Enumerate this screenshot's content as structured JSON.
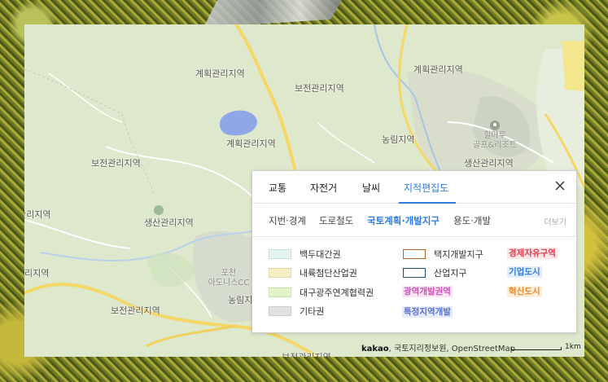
{
  "map": {
    "region_labels": [
      "계획관리지역",
      "보전관리지역",
      "계획관리지역",
      "계획관리지역",
      "농림지역",
      "보전관리지역",
      "생산관리지역",
      "관리지역",
      "생산관리지역",
      "리지역",
      "보전관리지역",
      "농림지",
      "보전관리지역"
    ],
    "poi": {
      "golf_line1": "힐마루",
      "golf_line2": "골프&리조트",
      "park_name": "포천",
      "park_sub": "아도니스CC"
    },
    "attribution": {
      "brand": "kakao",
      "text": ", 국토지리정보원, OpenStreetMap"
    },
    "scale_label": "1km"
  },
  "panel": {
    "tabs": [
      "교통",
      "자전거",
      "날씨",
      "지적편집도"
    ],
    "active_tab": "지적편집도",
    "close_icon": "close-icon",
    "subtabs": [
      "지번·경계",
      "도로철도",
      "국토계획·개발지구",
      "용도·개발"
    ],
    "active_subtab": "국토계획·개발지구",
    "more_label": "더보기",
    "legend": {
      "swatches": [
        {
          "label": "백두대간권",
          "color": "#e4f3f3"
        },
        {
          "label": "내륙첨단산업권",
          "color": "#f7efc4"
        },
        {
          "label": "대구광주연계협력권",
          "color": "#e2f5c8"
        },
        {
          "label": "기타권",
          "color": "#e2e2e2"
        }
      ],
      "outlines": [
        {
          "label": "택지개발지구",
          "color": "#b5652d"
        },
        {
          "label": "산업지구",
          "color": "#1f4e79"
        }
      ],
      "tags": [
        {
          "label": "광역개발권역",
          "color": "#d04eb8"
        },
        {
          "label": "특정지역개발",
          "color": "#5b6fd6"
        },
        {
          "label": "경제자유구역",
          "color": "#e23b4c"
        },
        {
          "label": "기업도시",
          "color": "#2d7be0"
        },
        {
          "label": "혁신도시",
          "color": "#f08a24"
        }
      ]
    }
  }
}
